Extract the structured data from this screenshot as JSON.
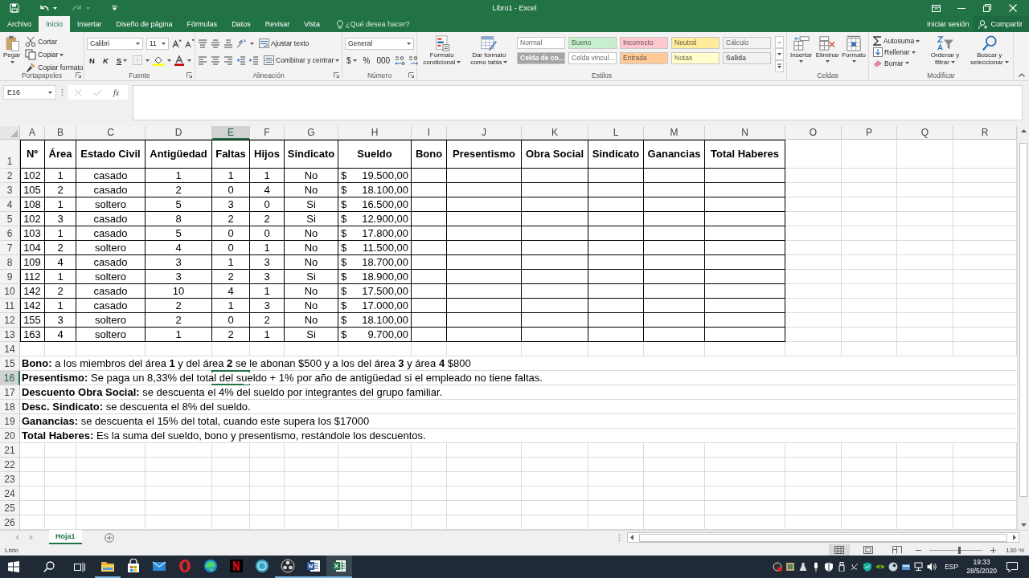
{
  "window": {
    "title": "Libro1 - Excel"
  },
  "tabs": [
    {
      "label": "Archivo",
      "selected": false
    },
    {
      "label": "Inicio",
      "selected": true
    },
    {
      "label": "Insertar",
      "selected": false
    },
    {
      "label": "Diseño de página",
      "selected": false
    },
    {
      "label": "Fórmulas",
      "selected": false
    },
    {
      "label": "Datos",
      "selected": false
    },
    {
      "label": "Revisar",
      "selected": false
    },
    {
      "label": "Vista",
      "selected": false
    }
  ],
  "tell_me": {
    "placeholder": "¿Qué desea hacer?"
  },
  "account": {
    "sign_in": "Iniciar sesión",
    "share": "Compartir"
  },
  "ribbon": [
    {
      "kind": "clipboard",
      "label": "Portapapeles",
      "paste": "Pegar",
      "items": [
        "Cortar",
        "Copiar",
        "Copiar formato"
      ]
    },
    {
      "kind": "font",
      "label": "Fuente",
      "font": "Calibri",
      "size": "11",
      "styles": [
        "N",
        "K",
        "S"
      ]
    },
    {
      "kind": "alignment",
      "label": "Alineación",
      "wrap": "Ajustar texto",
      "merge": "Combinar y centrar"
    },
    {
      "kind": "number",
      "label": "Número",
      "format": "General",
      "symbols": [
        "$",
        "%",
        "000"
      ]
    },
    {
      "kind": "styles",
      "label": "Estilos",
      "buttons": [
        "Formato condicional",
        "Dar formato como tabla"
      ],
      "cell_styles": [
        {
          "label": "Normal",
          "color": "#ffffff",
          "bold": false
        },
        {
          "label": "Bueno",
          "color": "#c6efce",
          "bold": false
        },
        {
          "label": "Incorrecto",
          "color": "#ffc7ce",
          "bold": false
        },
        {
          "label": "Neutral",
          "color": "#ffeb9c",
          "bold": false
        },
        {
          "label": "Cálculo",
          "color": "#f2f2f2",
          "bold": false
        },
        {
          "label": "Celda de co...",
          "color": "#a5a5a5",
          "bold": true
        },
        {
          "label": "Celda vincul...",
          "color": "#ffffff",
          "bold": false
        },
        {
          "label": "Entrada",
          "color": "#ffcc99",
          "bold": false
        },
        {
          "label": "Notas",
          "color": "#ffffcc",
          "bold": false
        },
        {
          "label": "Salida",
          "color": "#f2f2f2",
          "bold": true
        }
      ]
    },
    {
      "kind": "cells",
      "label": "Celdas",
      "buttons": [
        "Insertar",
        "Eliminar",
        "Formato"
      ]
    },
    {
      "kind": "editing",
      "label": "Modificar",
      "items": [
        "Autosuma",
        "Rellenar",
        "Borrar"
      ],
      "buttons": [
        "Ordenar y filtrar",
        "Buscar y seleccionar"
      ]
    }
  ],
  "formula_bar": {
    "name_box": "E16",
    "function_label": "fx"
  },
  "sheet": {
    "columns": [
      {
        "label": "A",
        "selected": false
      },
      {
        "label": "B",
        "selected": false
      },
      {
        "label": "C",
        "selected": false
      },
      {
        "label": "D",
        "selected": false
      },
      {
        "label": "E",
        "selected": true
      },
      {
        "label": "F",
        "selected": false
      },
      {
        "label": "G",
        "selected": false
      },
      {
        "label": "H",
        "selected": false
      },
      {
        "label": "I",
        "selected": false
      },
      {
        "label": "J",
        "selected": false
      },
      {
        "label": "K",
        "selected": false
      },
      {
        "label": "L",
        "selected": false
      },
      {
        "label": "M",
        "selected": false
      },
      {
        "label": "N",
        "selected": false
      },
      {
        "label": "O",
        "selected": false
      },
      {
        "label": "P",
        "selected": false
      },
      {
        "label": "Q",
        "selected": false
      },
      {
        "label": "R",
        "selected": false
      }
    ],
    "rows": [
      {
        "label": "1",
        "selected": false
      },
      {
        "label": "2",
        "selected": false
      },
      {
        "label": "3",
        "selected": false
      },
      {
        "label": "4",
        "selected": false
      },
      {
        "label": "5",
        "selected": false
      },
      {
        "label": "6",
        "selected": false
      },
      {
        "label": "7",
        "selected": false
      },
      {
        "label": "8",
        "selected": false
      },
      {
        "label": "9",
        "selected": false
      },
      {
        "label": "10",
        "selected": false
      },
      {
        "label": "11",
        "selected": false
      },
      {
        "label": "12",
        "selected": false
      },
      {
        "label": "13",
        "selected": false
      },
      {
        "label": "14",
        "selected": false
      },
      {
        "label": "15",
        "selected": false
      },
      {
        "label": "16",
        "selected": true
      },
      {
        "label": "17",
        "selected": false
      },
      {
        "label": "18",
        "selected": false
      },
      {
        "label": "19",
        "selected": false
      },
      {
        "label": "20",
        "selected": false
      },
      {
        "label": "21",
        "selected": false
      },
      {
        "label": "22",
        "selected": false
      },
      {
        "label": "23",
        "selected": false
      },
      {
        "label": "24",
        "selected": false
      },
      {
        "label": "25",
        "selected": false
      },
      {
        "label": "26",
        "selected": false
      }
    ],
    "table": {
      "header": [
        {
          "label": "Nº",
          "kind": "text"
        },
        {
          "label": "Área",
          "kind": "text"
        },
        {
          "label": "Estado Civil",
          "kind": "text"
        },
        {
          "label": "Antigüedad",
          "kind": "text"
        },
        {
          "label": "Faltas",
          "kind": "text"
        },
        {
          "label": "Hijos",
          "kind": "text"
        },
        {
          "label": "Sindicato",
          "kind": "text"
        },
        {
          "label": "Sueldo",
          "kind": "currency"
        },
        {
          "label": "Bono",
          "kind": "text"
        },
        {
          "label": "Presentismo",
          "kind": "text"
        },
        {
          "label": "Obra Social",
          "kind": "text"
        },
        {
          "label": "Sindicato",
          "kind": "text"
        },
        {
          "label": "Ganancias",
          "kind": "text"
        },
        {
          "label": "Total Haberes",
          "kind": "text"
        }
      ],
      "rows": [
        [
          "102",
          "1",
          "casado",
          "1",
          "1",
          "1",
          "No",
          "$ 19.500,00"
        ],
        [
          "105",
          "2",
          "casado",
          "2",
          "0",
          "4",
          "No",
          "$ 18.100,00"
        ],
        [
          "108",
          "1",
          "soltero",
          "5",
          "3",
          "0",
          "Si",
          "$ 16.500,00"
        ],
        [
          "102",
          "3",
          "casado",
          "8",
          "2",
          "2",
          "Si",
          "$ 12.900,00"
        ],
        [
          "103",
          "1",
          "casado",
          "5",
          "0",
          "0",
          "No",
          "$ 17.800,00"
        ],
        [
          "104",
          "2",
          "soltero",
          "4",
          "0",
          "1",
          "No",
          "$ 11.500,00"
        ],
        [
          "109",
          "4",
          "casado",
          "3",
          "1",
          "3",
          "No",
          "$ 18.700,00"
        ],
        [
          "112",
          "1",
          "soltero",
          "3",
          "2",
          "3",
          "Si",
          "$ 18.900,00"
        ],
        [
          "142",
          "2",
          "casado",
          "10",
          "4",
          "1",
          "No",
          "$ 17.500,00"
        ],
        [
          "142",
          "1",
          "casado",
          "2",
          "1",
          "3",
          "No",
          "$ 17.000,00"
        ],
        [
          "155",
          "3",
          "soltero",
          "2",
          "0",
          "2",
          "No",
          "$ 18.100,00"
        ],
        [
          "163",
          "4",
          "soltero",
          "1",
          "2",
          "1",
          "Si",
          "$ 9.700,00"
        ]
      ]
    },
    "notes": [
      "**Bono:** a los miembros del área **1** y del área **2** se le abonan $500 y a los del área **3** y área **4** $800",
      "**Presentismo:** Se paga un 8,33% del total del sueldo + 1% por año de antigüedad si el empleado no tiene faltas.",
      "**Descuento Obra Social:** se descuenta el 4% del sueldo por integrantes del grupo familiar.",
      "**Desc. Sindicato:** se descuenta el 8% del sueldo.",
      "**Ganancias:** se descuenta el 15% del total, cuando este supera los $17000",
      "**Total Haberes:** Es la suma del sueldo, bono y presentismo, restándole los descuentos."
    ]
  },
  "sheet_tabs": [
    {
      "label": "Hoja1",
      "selected": true
    }
  ],
  "status_bar": {
    "status": "Listo",
    "views": [
      {
        "kind": "normal",
        "selected": true
      },
      {
        "kind": "page_layout",
        "selected": false
      },
      {
        "kind": "page_break",
        "selected": false
      }
    ],
    "zoom_slider": {
      "level": 0.55
    },
    "zoom": "130 %"
  },
  "taskbar": {
    "apps": [
      {
        "kind": "folder",
        "running": true,
        "selected": false
      },
      {
        "kind": "store",
        "running": false,
        "selected": false
      },
      {
        "kind": "mail",
        "running": false,
        "selected": false
      },
      {
        "kind": "opera",
        "running": false,
        "selected": false
      },
      {
        "kind": "edge",
        "running": false,
        "selected": false
      },
      {
        "kind": "stripes",
        "running": false,
        "selected": false
      },
      {
        "kind": "circle",
        "running": false,
        "selected": false
      },
      {
        "kind": "aperture",
        "running": true,
        "selected": false
      },
      {
        "kind": "word",
        "running": true,
        "selected": false
      },
      {
        "kind": "excel",
        "running": true,
        "selected": true
      }
    ],
    "language": "ESP",
    "time": "19:33",
    "date": "28/5/2020"
  }
}
